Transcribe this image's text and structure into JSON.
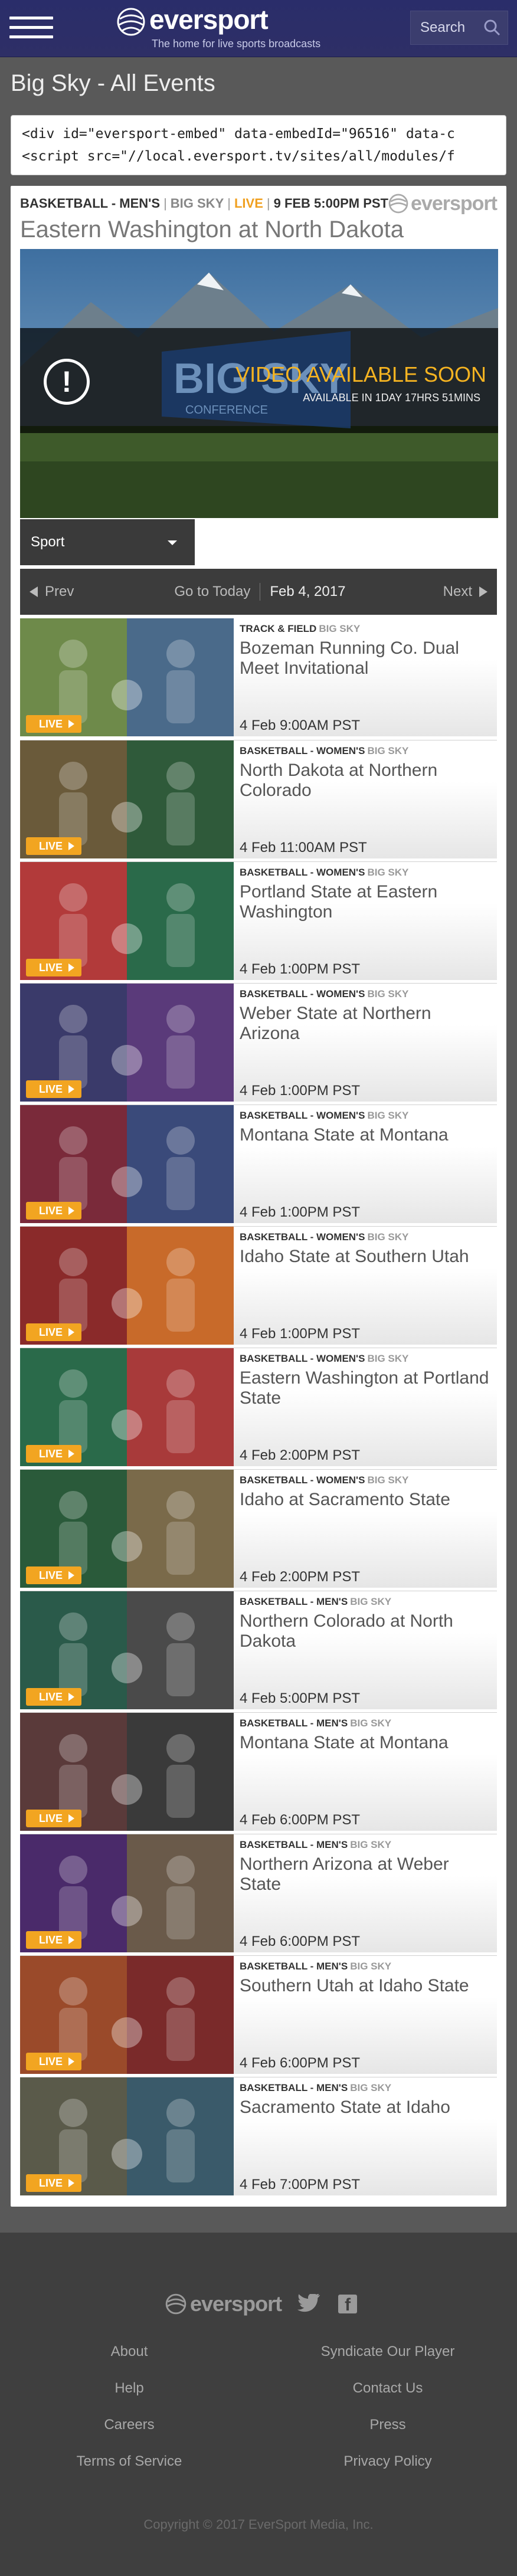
{
  "header": {
    "menu_label": "menu",
    "brand": "eversport",
    "tagline": "The home for live sports broadcasts",
    "search_placeholder": "Search"
  },
  "page": {
    "title": "Big Sky - All Events",
    "embed_line1": "<div id=\"eversport-embed\" data-embedId=\"96516\" data-c",
    "embed_line2": "<script src=\"//local.eversport.tv/sites/all/modules/f"
  },
  "featured": {
    "sport": "BASKETBALL - MEN'S",
    "conference": "BIG SKY",
    "live": "LIVE",
    "datetime": "9 FEB 5:00PM PST",
    "title": "Eastern Washington at North Dakota",
    "video_status": "VIDEO AVAILABLE SOON",
    "video_countdown": "AVAILABLE IN 1DAY 17HRS 51MINS",
    "conf_logo_text": "BIG SKY",
    "conf_logo_sub": "CONFERENCE"
  },
  "filters": {
    "sport_select": "Sport",
    "prev": "Prev",
    "today": "Go to Today",
    "current_date": "Feb 4, 2017",
    "next": "Next"
  },
  "live_label": "LIVE",
  "events": [
    {
      "sport": "TRACK & FIELD",
      "conf": "BIG SKY",
      "name": "Bozeman Running Co. Dual Meet Invitational",
      "time": "4 Feb 9:00AM PST",
      "c1": "#6e8a4a",
      "c2": "#4a6a8a"
    },
    {
      "sport": "BASKETBALL - WOMEN'S",
      "conf": "BIG SKY",
      "name": "North Dakota at Northern Colorado",
      "time": "4 Feb 11:00AM PST",
      "c1": "#6a5a3a",
      "c2": "#2f5a3a"
    },
    {
      "sport": "BASKETBALL - WOMEN'S",
      "conf": "BIG SKY",
      "name": "Portland State at Eastern Washington",
      "time": "4 Feb 1:00PM PST",
      "c1": "#b23a3a",
      "c2": "#2a6a4a"
    },
    {
      "sport": "BASKETBALL - WOMEN'S",
      "conf": "BIG SKY",
      "name": "Weber State at Northern Arizona",
      "time": "4 Feb 1:00PM PST",
      "c1": "#3a3a6a",
      "c2": "#5a3a7a"
    },
    {
      "sport": "BASKETBALL - WOMEN'S",
      "conf": "BIG SKY",
      "name": "Montana State at Montana",
      "time": "4 Feb 1:00PM PST",
      "c1": "#7a2a3a",
      "c2": "#3a4a7a"
    },
    {
      "sport": "BASKETBALL - WOMEN'S",
      "conf": "BIG SKY",
      "name": "Idaho State at Southern Utah",
      "time": "4 Feb 1:00PM PST",
      "c1": "#8a2a2a",
      "c2": "#c86a2a"
    },
    {
      "sport": "BASKETBALL - WOMEN'S",
      "conf": "BIG SKY",
      "name": "Eastern Washington at Portland State",
      "time": "4 Feb 2:00PM PST",
      "c1": "#2a6a4a",
      "c2": "#a83a3a"
    },
    {
      "sport": "BASKETBALL - WOMEN'S",
      "conf": "BIG SKY",
      "name": "Idaho at Sacramento State",
      "time": "4 Feb 2:00PM PST",
      "c1": "#2a5a3a",
      "c2": "#7a6a4a"
    },
    {
      "sport": "BASKETBALL - MEN'S",
      "conf": "BIG SKY",
      "name": "Northern Colorado at North Dakota",
      "time": "4 Feb 5:00PM PST",
      "c1": "#2a5a4a",
      "c2": "#4a4a4a"
    },
    {
      "sport": "BASKETBALL - MEN'S",
      "conf": "BIG SKY",
      "name": "Montana State at Montana",
      "time": "4 Feb 6:00PM PST",
      "c1": "#5a3a3a",
      "c2": "#3a3a3a"
    },
    {
      "sport": "BASKETBALL - MEN'S",
      "conf": "BIG SKY",
      "name": "Northern Arizona at Weber State",
      "time": "4 Feb 6:00PM PST",
      "c1": "#4a2a6a",
      "c2": "#6a5a4a"
    },
    {
      "sport": "BASKETBALL - MEN'S",
      "conf": "BIG SKY",
      "name": "Southern Utah at Idaho State",
      "time": "4 Feb 6:00PM PST",
      "c1": "#9a4a2a",
      "c2": "#7a2a2a"
    },
    {
      "sport": "BASKETBALL - MEN'S",
      "conf": "BIG SKY",
      "name": "Sacramento State at Idaho",
      "time": "4 Feb 7:00PM PST",
      "c1": "#5a5a4a",
      "c2": "#3a5a6a"
    }
  ],
  "footer": {
    "brand": "eversport",
    "links_left": [
      "About",
      "Help",
      "Careers",
      "Terms of Service"
    ],
    "links_right": [
      "Syndicate Our Player",
      "Contact Us",
      "Press",
      "Privacy Policy"
    ],
    "copyright": "Copyright © 2017 EverSport Media, Inc."
  },
  "colors": {
    "header_bg": "#2e2f66",
    "accent_live": "#f2a521",
    "video_soon": "#f5b321",
    "page_bg": "#595959"
  }
}
